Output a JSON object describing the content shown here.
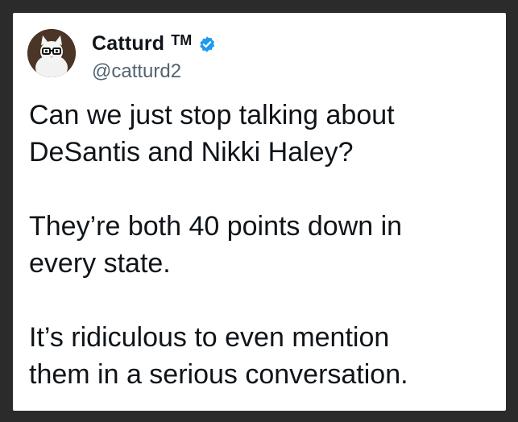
{
  "author": {
    "display_name": "Catturd",
    "trademark": "TM",
    "handle": "@catturd2",
    "verified": true,
    "verified_color": "#1d9bf0",
    "avatar_icon": "cat-avatar"
  },
  "tweet": {
    "paragraphs": [
      "Can we just stop talking about\nDeSantis and Nikki Haley?",
      "They’re both 40 points down in\nevery state.",
      "It’s ridiculous to even mention\nthem in a serious conversation."
    ]
  }
}
